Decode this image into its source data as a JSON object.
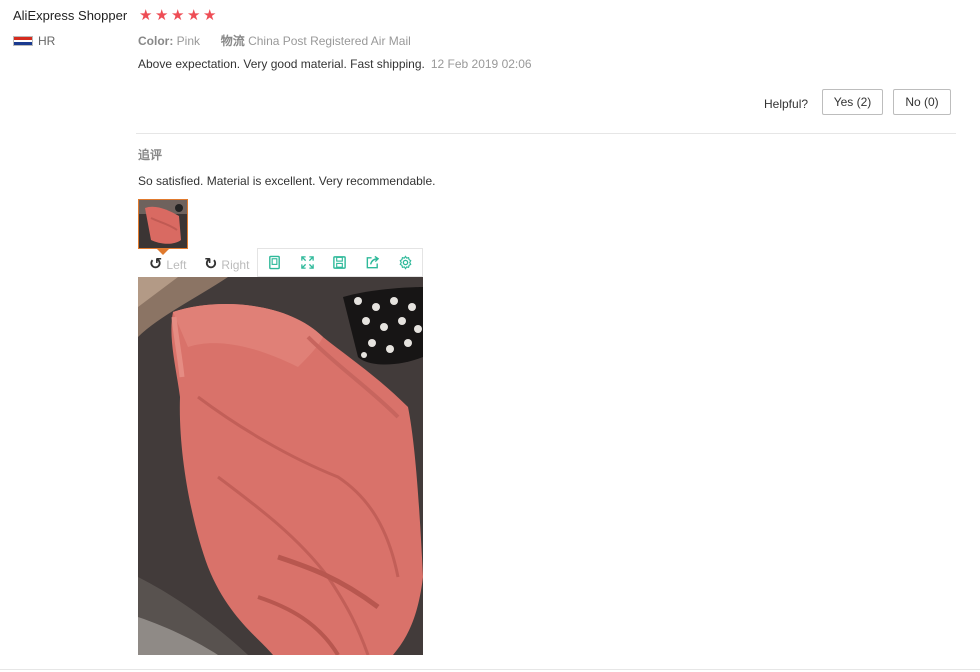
{
  "buyer": {
    "name": "AliExpress Shopper",
    "country": "HR",
    "rating_stars": 5
  },
  "review": {
    "color_label": "Color:",
    "color_value": "Pink",
    "shipping_label": "物流",
    "shipping_value": "China Post Registered Air Mail",
    "text": "Above expectation. Very good material. Fast shipping.",
    "date": "12 Feb 2019 02:06"
  },
  "helpful": {
    "label": "Helpful?",
    "yes": "Yes (2)",
    "no": "No (0)"
  },
  "additional": {
    "label": "追评",
    "text": "So satisfied. Material is excellent. Very recommendable."
  },
  "viewer": {
    "rotate_left": "Left",
    "rotate_right": "Right",
    "tools": [
      "fit-icon",
      "fullscreen-icon",
      "save-icon",
      "share-icon",
      "settings-icon"
    ]
  },
  "colors": {
    "star": "#ee4d55",
    "tool_icon": "#2fb99a",
    "thumb_border": "#e07a2e"
  }
}
